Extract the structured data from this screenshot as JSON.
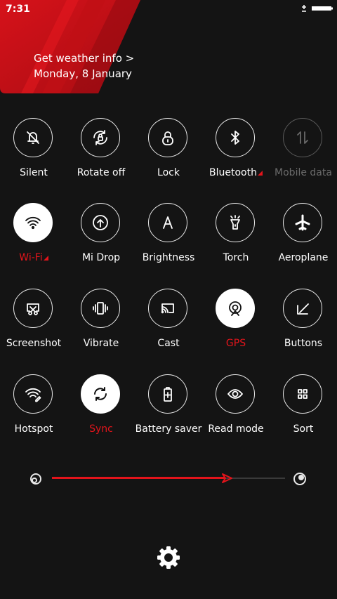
{
  "status_bar": {
    "time": "7:31",
    "battery_level": 1.0
  },
  "header": {
    "weather_link": "Get weather info >",
    "date": "Monday, 8 January"
  },
  "colors": {
    "accent": "#e3141b",
    "background": "#141414",
    "tile_border": "#e8e8e8",
    "disabled": "#6a6a6a"
  },
  "toggles": [
    {
      "label": "Silent",
      "icon": "bell-off-icon",
      "state": "off"
    },
    {
      "label": "Rotate off",
      "icon": "rotate-lock-icon",
      "state": "off"
    },
    {
      "label": "Lock",
      "icon": "lock-icon",
      "state": "off"
    },
    {
      "label": "Bluetooth",
      "icon": "bluetooth-icon",
      "state": "off",
      "has_more": true
    },
    {
      "label": "Mobile data",
      "icon": "mobile-data-icon",
      "state": "disabled"
    },
    {
      "label": "Wi-Fi",
      "icon": "wifi-icon",
      "state": "on",
      "has_more": true
    },
    {
      "label": "Mi Drop",
      "icon": "mi-drop-icon",
      "state": "off"
    },
    {
      "label": "Brightness",
      "icon": "brightness-auto-icon",
      "state": "off"
    },
    {
      "label": "Torch",
      "icon": "torch-icon",
      "state": "off"
    },
    {
      "label": "Aeroplane",
      "icon": "airplane-icon",
      "state": "off"
    },
    {
      "label": "Screenshot",
      "icon": "screenshot-icon",
      "state": "off"
    },
    {
      "label": "Vibrate",
      "icon": "vibrate-icon",
      "state": "off"
    },
    {
      "label": "Cast",
      "icon": "cast-icon",
      "state": "off"
    },
    {
      "label": "GPS",
      "icon": "gps-icon",
      "state": "on"
    },
    {
      "label": "Buttons",
      "icon": "buttons-icon",
      "state": "off"
    },
    {
      "label": "Hotspot",
      "icon": "hotspot-icon",
      "state": "off"
    },
    {
      "label": "Sync",
      "icon": "sync-icon",
      "state": "on"
    },
    {
      "label": "Battery saver",
      "icon": "battery-saver-icon",
      "state": "off"
    },
    {
      "label": "Read mode",
      "icon": "eye-icon",
      "state": "off"
    },
    {
      "label": "Sort",
      "icon": "grid-sort-icon",
      "state": "off"
    }
  ],
  "brightness": {
    "level": 0.74,
    "min_icon": "brightness-low-icon",
    "max_icon": "brightness-high-icon"
  },
  "footer": {
    "settings_icon": "gear-icon"
  }
}
